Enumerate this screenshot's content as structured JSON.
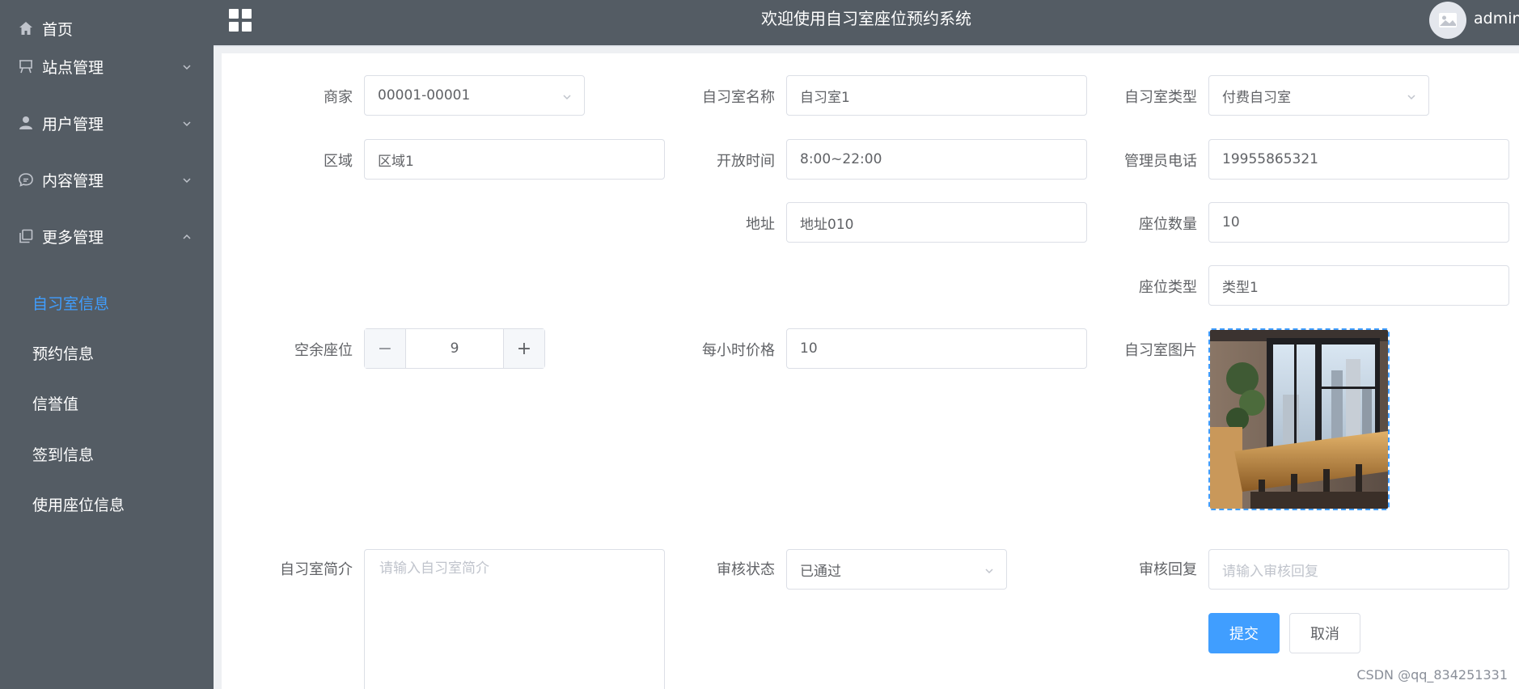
{
  "sidebar": {
    "items": [
      {
        "label": "首页",
        "icon": "home-icon"
      },
      {
        "label": "站点管理",
        "icon": "easel-icon"
      },
      {
        "label": "用户管理",
        "icon": "user-icon"
      },
      {
        "label": "内容管理",
        "icon": "chat-icon"
      },
      {
        "label": "更多管理",
        "icon": "copy-icon"
      }
    ],
    "sub_items": [
      {
        "label": "自习室信息",
        "active": true
      },
      {
        "label": "预约信息"
      },
      {
        "label": "信誉值"
      },
      {
        "label": "签到信息"
      },
      {
        "label": "使用座位信息"
      }
    ]
  },
  "header": {
    "title": "欢迎使用自习室座位预约系统",
    "username": "admin"
  },
  "form": {
    "merchant": {
      "label": "商家",
      "value": "00001-00001"
    },
    "room_name": {
      "label": "自习室名称",
      "value": "自习室1"
    },
    "room_type": {
      "label": "自习室类型",
      "value": "付费自习室"
    },
    "area": {
      "label": "区域",
      "value": "区域1"
    },
    "open_time": {
      "label": "开放时间",
      "value": "8:00~22:00"
    },
    "admin_phone": {
      "label": "管理员电话",
      "value": "19955865321"
    },
    "address": {
      "label": "地址",
      "value": "地址010"
    },
    "seat_count": {
      "label": "座位数量",
      "value": "10"
    },
    "seat_type": {
      "label": "座位类型",
      "value": "类型1"
    },
    "free_seats": {
      "label": "空余座位",
      "value": "9",
      "minus": "−",
      "plus": "+"
    },
    "hourly_price": {
      "label": "每小时价格",
      "value": "10"
    },
    "room_image": {
      "label": "自习室图片"
    },
    "intro": {
      "label": "自习室简介",
      "placeholder": "请输入自习室简介"
    },
    "review_status": {
      "label": "审核状态",
      "value": "已通过"
    },
    "review_reply": {
      "label": "审核回复",
      "placeholder": "请输入审核回复"
    },
    "submit_label": "提交",
    "cancel_label": "取消"
  },
  "watermark": "CSDN @qq_834251331",
  "colors": {
    "sidebar_bg": "#545c64",
    "accent": "#409eff",
    "border": "#dcdfe6"
  }
}
